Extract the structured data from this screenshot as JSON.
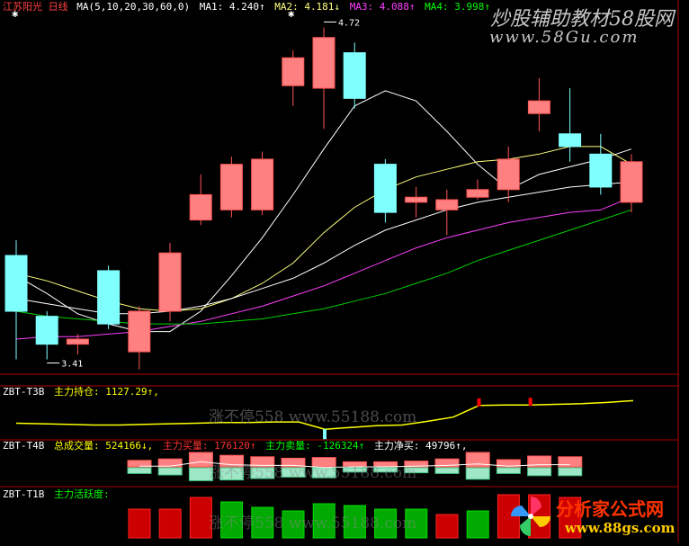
{
  "colors": {
    "up_fill": "#ff8080",
    "up_outline": "#ff5555",
    "down_fill": "#80ffff",
    "white": "#ffffff",
    "yellow": "#ffff00",
    "magenta": "#ff00ff",
    "green": "#00ff00",
    "red": "#ff3333",
    "divider": "#b00000",
    "ma5": "#ffffff",
    "ma10": "#ffff80",
    "ma20": "#ffffff",
    "ma30": "#ff40ff",
    "ma60": "#00d000"
  },
  "header": {
    "stock_name": "江苏阳光",
    "period": "日线",
    "ma_params": "MA(5,10,20,30,60,0)",
    "ma1": "MA1: 4.240↑",
    "ma2": "MA2: 4.181↓",
    "ma3": "MA3: 4.088↑",
    "ma4": "MA4: 3.998↑"
  },
  "watermarks": {
    "top_brand": "炒股辅助教材58股网",
    "top_url": "www.58Gu.com",
    "corner_brand": "分析家公式网",
    "corner_url": "www.88gs.com",
    "faint1": "涨不停558 www.55188.com",
    "faint2": "涨不停558 www.55188.com",
    "faint3": "涨不停558 www.55188.com"
  },
  "panel1": {
    "title": "ZBT-T3B",
    "label": "主力持仓: 1127.29↑,"
  },
  "panel2": {
    "title": "ZBT-T4B",
    "total_volume": "总成交量: 524166↓,",
    "main_buy": "主力买量: 176120↑",
    "main_sell": "主力卖量: -126324↑",
    "main_net": "主力净买: 49796↑,"
  },
  "panel3": {
    "title": "ZBT-T1B",
    "label": "主力活跃度:"
  },
  "chart_data": [
    {
      "type": "candlestick",
      "title": "江苏阳光 日线",
      "candles": [
        {
          "open": 3.82,
          "close": 3.6,
          "high": 3.88,
          "low": 3.41
        },
        {
          "open": 3.58,
          "close": 3.47,
          "high": 3.6,
          "low": 3.41
        },
        {
          "open": 3.47,
          "close": 3.49,
          "high": 3.51,
          "low": 3.43
        },
        {
          "open": 3.76,
          "close": 3.55,
          "high": 3.78,
          "low": 3.53
        },
        {
          "open": 3.44,
          "close": 3.6,
          "high": 3.62,
          "low": 3.37
        },
        {
          "open": 3.6,
          "close": 3.83,
          "high": 3.87,
          "low": 3.56
        },
        {
          "open": 3.96,
          "close": 4.06,
          "high": 4.14,
          "low": 3.94
        },
        {
          "open": 4.0,
          "close": 4.18,
          "high": 4.21,
          "low": 3.97
        },
        {
          "open": 4.0,
          "close": 4.2,
          "high": 4.23,
          "low": 3.98
        },
        {
          "open": 4.49,
          "close": 4.6,
          "high": 4.63,
          "low": 4.41
        },
        {
          "open": 4.48,
          "close": 4.68,
          "high": 4.72,
          "low": 4.32
        },
        {
          "open": 4.62,
          "close": 4.44,
          "high": 4.66,
          "low": 4.4
        },
        {
          "open": 4.18,
          "close": 3.99,
          "high": 4.2,
          "low": 3.95
        },
        {
          "open": 4.03,
          "close": 4.05,
          "high": 4.09,
          "low": 3.97
        },
        {
          "open": 4.0,
          "close": 4.04,
          "high": 4.08,
          "low": 3.9
        },
        {
          "open": 4.05,
          "close": 4.08,
          "high": 4.12,
          "low": 4.04
        },
        {
          "open": 4.08,
          "close": 4.2,
          "high": 4.25,
          "low": 4.03
        },
        {
          "open": 4.38,
          "close": 4.43,
          "high": 4.52,
          "low": 4.31
        },
        {
          "open": 4.3,
          "close": 4.25,
          "high": 4.48,
          "low": 4.19
        },
        {
          "open": 4.22,
          "close": 4.09,
          "high": 4.3,
          "low": 4.06
        },
        {
          "open": 4.03,
          "close": 4.19,
          "high": 4.22,
          "low": 3.99
        }
      ],
      "ma_lines": {
        "ma5": [
          3.74,
          3.67,
          3.59,
          3.55,
          3.52,
          3.52,
          3.6,
          3.74,
          3.89,
          4.06,
          4.24,
          4.41,
          4.47,
          4.43,
          4.31,
          4.18,
          4.08,
          4.14,
          4.17,
          4.2,
          4.24
        ],
        "ma10": [
          3.75,
          3.72,
          3.68,
          3.64,
          3.61,
          3.6,
          3.61,
          3.65,
          3.71,
          3.79,
          3.91,
          4.01,
          4.08,
          4.13,
          4.16,
          4.19,
          4.2,
          4.22,
          4.25,
          4.25,
          4.18
        ],
        "ma20": [
          3.65,
          3.63,
          3.61,
          3.59,
          3.59,
          3.6,
          3.62,
          3.65,
          3.69,
          3.73,
          3.79,
          3.86,
          3.92,
          3.96,
          4.0,
          4.03,
          4.05,
          4.07,
          4.09,
          4.1,
          4.11
        ],
        "ma30": [
          3.49,
          3.5,
          3.5,
          3.51,
          3.52,
          3.54,
          3.56,
          3.59,
          3.62,
          3.66,
          3.7,
          3.75,
          3.8,
          3.85,
          3.89,
          3.92,
          3.95,
          3.97,
          3.99,
          4.0,
          4.05
        ],
        "ma60": [
          3.6,
          3.58,
          3.57,
          3.56,
          3.55,
          3.55,
          3.55,
          3.56,
          3.57,
          3.59,
          3.61,
          3.64,
          3.67,
          3.71,
          3.75,
          3.8,
          3.84,
          3.88,
          3.92,
          3.96,
          4.0
        ]
      },
      "annotations": [
        {
          "text": "3.41",
          "candle_index": 1
        },
        {
          "text": "4.72",
          "candle_index": 10
        }
      ],
      "ylim": [
        3.38,
        4.75
      ]
    },
    {
      "type": "line",
      "title": "主力持仓",
      "values": [
        1090,
        1089,
        1088,
        1087,
        1087,
        1088,
        1089,
        1090,
        1091,
        1091,
        1092,
        1092,
        1080,
        1083,
        1086,
        1087,
        1093,
        1100,
        1119,
        1120,
        1120,
        1121,
        1122,
        1124,
        1127
      ],
      "ylim": [
        1070,
        1135
      ]
    },
    {
      "type": "bar",
      "title": "ZBT-T4B",
      "series": [
        {
          "name": "主力买量",
          "values": [
            0.45,
            0.55,
            1.0,
            0.8,
            0.7,
            0.6,
            0.65,
            0.35,
            0.35,
            0.4,
            0.55,
            1.0,
            0.5,
            0.75,
            0.7
          ]
        },
        {
          "name": "主力卖量",
          "values": [
            0.4,
            0.5,
            0.9,
            0.85,
            0.75,
            0.65,
            0.7,
            0.3,
            0.3,
            0.35,
            0.4,
            0.8,
            0.4,
            0.55,
            0.55
          ]
        }
      ],
      "line": [
        0.05,
        0.05,
        0.35,
        0.15,
        0.1,
        0.1,
        -0.05,
        0.0,
        0.0,
        0.05,
        0.1,
        0.2,
        0.05,
        0.15,
        0.15
      ]
    },
    {
      "type": "bar",
      "title": "主力活跃度",
      "values": [
        32,
        32,
        45,
        40,
        34,
        30,
        38,
        36,
        32,
        32,
        26,
        30,
        48,
        48,
        45
      ],
      "signs": [
        "up",
        "up",
        "up",
        "down",
        "down",
        "down",
        "down",
        "down",
        "down",
        "down",
        "up",
        "down",
        "up",
        "up",
        "up"
      ]
    }
  ]
}
